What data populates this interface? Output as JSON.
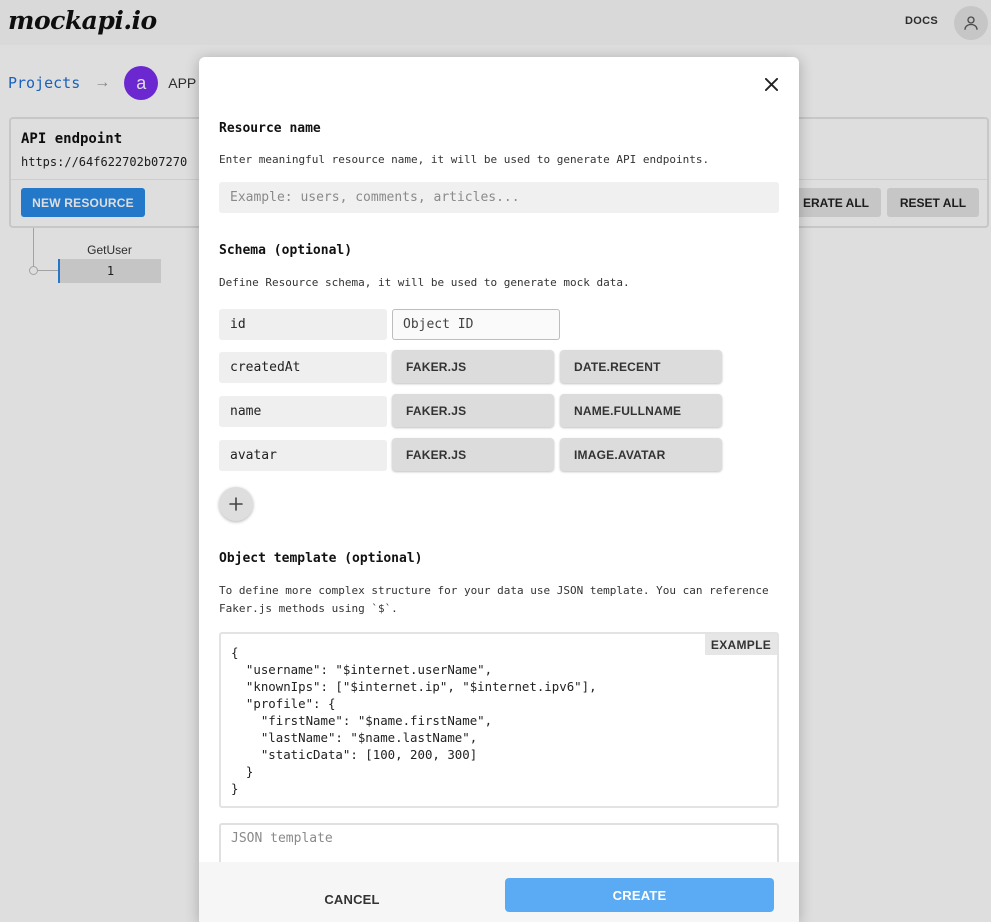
{
  "app": {
    "logo": "mockapi.io",
    "docs_label": "DOCS",
    "user_icon": "user-icon"
  },
  "breadcrumb": {
    "projects_label": "Projects",
    "arrow": "→",
    "project_avatar": "a",
    "project_name": "APP"
  },
  "endpoint_panel": {
    "title": "API endpoint",
    "url": "https://64f622702b07270",
    "new_resource_label": "NEW RESOURCE",
    "generate_all_label": "ERATE ALL",
    "reset_all_label": "RESET ALL"
  },
  "resources": [
    {
      "name": "GetUser",
      "count": "1"
    }
  ],
  "modal": {
    "close_icon": "close-icon",
    "resource_name": {
      "title": "Resource name",
      "hint": "Enter meaningful resource name, it will be used to generate API endpoints.",
      "placeholder": "Example: users, comments, articles...",
      "value": ""
    },
    "schema": {
      "title": "Schema (optional)",
      "hint": "Define Resource schema, it will be used to generate mock data.",
      "fields": [
        {
          "name": "id",
          "type_placeholder": "Object ID"
        },
        {
          "name": "createdAt",
          "type": "FAKER.JS",
          "method": "DATE.RECENT"
        },
        {
          "name": "name",
          "type": "FAKER.JS",
          "method": "NAME.FULLNAME"
        },
        {
          "name": "avatar",
          "type": "FAKER.JS",
          "method": "IMAGE.AVATAR"
        }
      ],
      "add_icon": "plus-icon"
    },
    "object_template": {
      "title": "Object template (optional)",
      "hint_line1": "To define more complex structure for your data use JSON template. You can reference",
      "hint_line2": "Faker.js methods using `$`.",
      "example_label": "EXAMPLE",
      "example_lines": [
        "{",
        "  \"username\": \"$internet.userName\",",
        "  \"knownIps\": [\"$internet.ip\", \"$internet.ipv6\"],",
        "  \"profile\": {",
        "    \"firstName\": \"$name.firstName\",",
        "    \"lastName\": \"$name.lastName\",",
        "    \"staticData\": [100, 200, 300]",
        "  }",
        "}"
      ],
      "json_placeholder": "JSON template"
    },
    "footer": {
      "cancel_label": "CANCEL",
      "create_label": "CREATE"
    }
  }
}
